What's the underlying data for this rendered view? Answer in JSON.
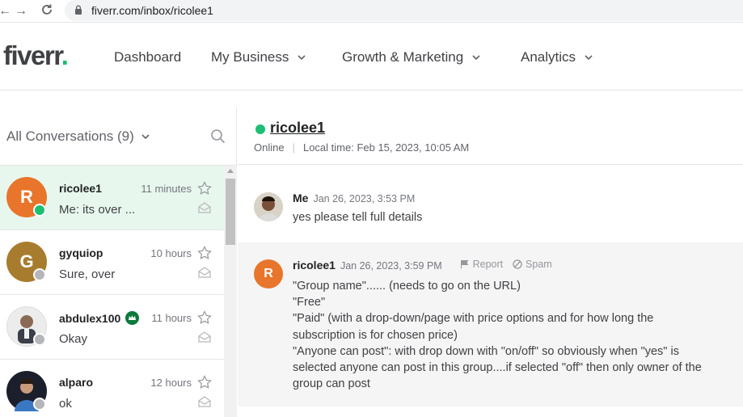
{
  "browser": {
    "url": "fiverr.com/inbox/ricolee1"
  },
  "brand": {
    "logo_text": "fiverr",
    "logo_dot": ".",
    "accent": "#1dbf73"
  },
  "nav": {
    "items": [
      {
        "label": "Dashboard"
      },
      {
        "label": "My Business"
      },
      {
        "label": "Growth & Marketing"
      },
      {
        "label": "Analytics"
      }
    ]
  },
  "sidebar": {
    "title": "All Conversations (9)",
    "conversations": [
      {
        "avatar_letter": "R",
        "avatar_color": "#e8752b",
        "name": "ricolee1",
        "time": "11 minutes",
        "preview": "Me: its over ...",
        "status_color": "#1dbf73"
      },
      {
        "avatar_letter": "G",
        "avatar_color": "#a87c2f",
        "name": "gyquiop",
        "time": "10 hours",
        "preview": "Sure, over",
        "status_color": "#b5b6ba"
      },
      {
        "avatar_letter": "",
        "avatar_color": "#e9e9e9",
        "name": "abdulex100",
        "time": "11 hours",
        "preview": "Okay",
        "status_color": "#b5b6ba"
      },
      {
        "avatar_letter": "",
        "avatar_color": "#1b1f2b",
        "name": "alparo",
        "time": "12 hours",
        "preview": "ok",
        "status_color": "#b5b6ba"
      }
    ]
  },
  "chat": {
    "username": "ricolee1",
    "status": "Online",
    "local_time": "Local time: Feb 15, 2023, 10:05 AM",
    "messages": [
      {
        "sender": "Me",
        "date": "Jan 26, 2023, 3:53 PM",
        "body": "yes please tell full details"
      },
      {
        "sender": "ricolee1",
        "avatar_letter": "R",
        "date": "Jan 26, 2023, 3:59 PM",
        "report_label": "Report",
        "spam_label": "Spam",
        "lines": [
          "\"Group name\"...... (needs to go on the URL)",
          "\"Free\"",
          "\"Paid\" (with a drop-down/page with price options and for how long the",
          "subscription is for chosen price)",
          "\"Anyone can post\": with drop down with \"on/off\" so obviously when \"yes\" is",
          "selected anyone can post in this group....if selected \"off\" then only owner of the",
          "group can post"
        ]
      }
    ]
  }
}
